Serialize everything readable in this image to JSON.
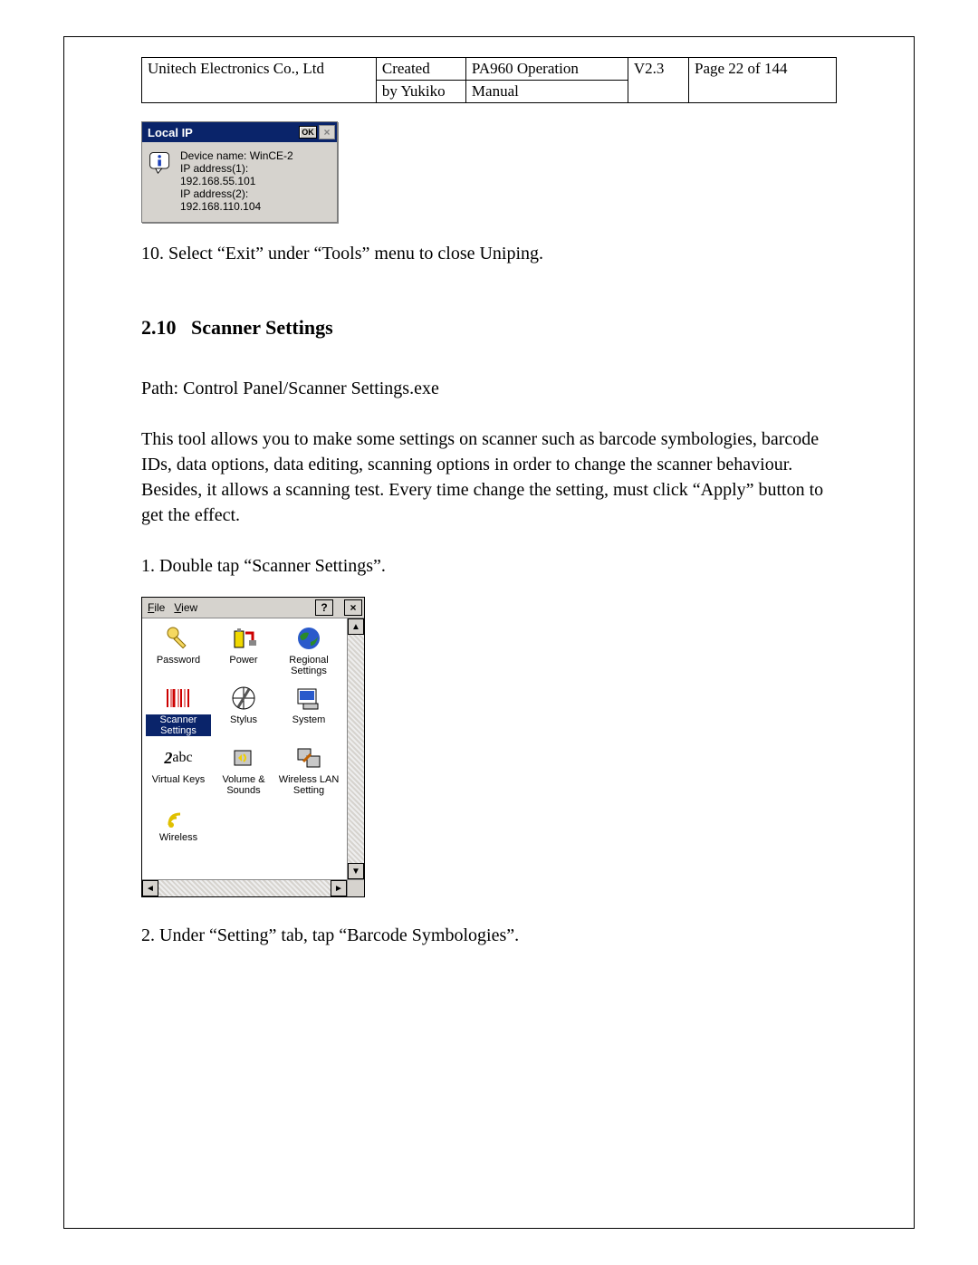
{
  "header": {
    "company": "Unitech Electronics Co., Ltd",
    "created_by_l1": "Created",
    "created_by_l2": "by Yukiko",
    "doc_l1": "PA960 Operation",
    "doc_l2": "Manual",
    "version": "V2.3",
    "page": "Page 22 of 144"
  },
  "dialog1": {
    "title": "Local IP",
    "ok": "OK",
    "line1": "Device name: WinCE-2",
    "line2": "IP address(1):",
    "line3": "192.168.55.101",
    "line4": "IP address(2):",
    "line5": "192.168.110.104"
  },
  "text": {
    "step10": "10. Select “Exit” under “Tools” menu to close Uniping.",
    "section_no": "2.10",
    "section_title": "Scanner Settings",
    "path": "Path: Control Panel/Scanner Settings.exe",
    "desc": "This tool allows you to make some settings on scanner such as barcode symbologies, barcode IDs, data options, data editing, scanning options in order to change the scanner behaviour. Besides, it allows a scanning test. Every time change the setting, must click “Apply” button to get the effect.",
    "step1": "1. Double tap “Scanner Settings”.",
    "step2": "2. Under “Setting” tab, tap “Barcode Symbologies”."
  },
  "cp": {
    "menu_file": "File",
    "menu_view": "View",
    "help": "?",
    "close": "×",
    "icons": {
      "password": "Password",
      "power": "Power",
      "regional": "Regional Settings",
      "scanner": "Scanner Settings",
      "stylus": "Stylus",
      "system": "System",
      "virtualkeys": "Virtual Keys",
      "volume": "Volume & Sounds",
      "wlan": "Wireless LAN Setting",
      "wireless": "Wireless"
    }
  }
}
